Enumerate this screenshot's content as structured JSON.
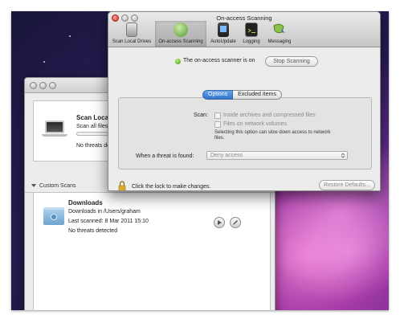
{
  "front_window": {
    "title": "On-access Scanning",
    "toolbar": [
      {
        "label": "Scan Local Drives",
        "icon": "scan-drives-icon"
      },
      {
        "label": "On-access Scanning",
        "icon": "on-access-icon",
        "selected": true
      },
      {
        "label": "AutoUpdate",
        "icon": "autoupdate-icon"
      },
      {
        "label": "Logging",
        "icon": "console-icon"
      },
      {
        "label": "Messaging",
        "icon": "messaging-icon"
      }
    ],
    "status_text": "The on-access scanner is on",
    "stop_button": "Stop Scanning",
    "tabs": [
      {
        "label": "Options",
        "active": true
      },
      {
        "label": "Excluded Items",
        "active": false
      }
    ],
    "scan_label": "Scan:",
    "options": [
      {
        "label": "Inside archives and compressed files",
        "checked": false
      },
      {
        "label": "Files on network volumes",
        "checked": false
      }
    ],
    "network_note": "Selecting this option can slow down access to network files.",
    "threat_label": "When a threat is found:",
    "threat_select_value": "Deny access",
    "lock_text": "Click the lock to make changes.",
    "restore_button": "Restore Defaults..."
  },
  "back_window": {
    "scan_local": {
      "title": "Scan Local Dri",
      "subtitle": "Scan all files and f",
      "status": "No threats detecte"
    },
    "custom_scans_header": "Custom Scans",
    "downloads": {
      "title": "Downloads",
      "path": "Downloads in /Users/graham",
      "last_scanned": "Last scanned: 8 Mar 2011 15:10",
      "status": "No threats detected"
    }
  },
  "colors": {
    "accent_blue": "#2f74cf",
    "status_green": "#3c9a16",
    "close_red": "#d13b2a"
  }
}
